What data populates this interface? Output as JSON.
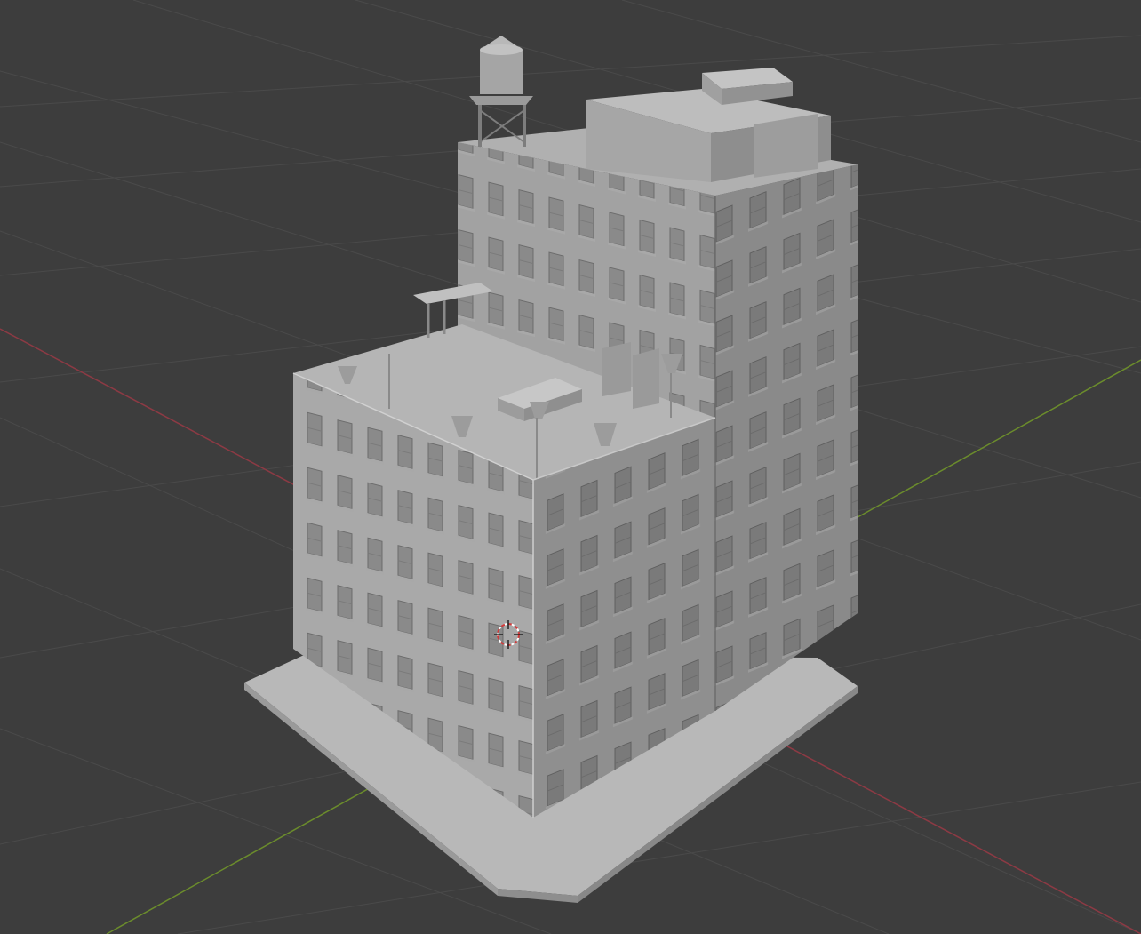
{
  "app": {
    "name": "3D viewport"
  },
  "scene": {
    "background": "#3d3d3d",
    "grid_color": "#4a4a4a",
    "x_axis_color": "#8c3a44",
    "y_axis_color": "#6b8c2c",
    "model_light": "#b3b3b3",
    "model_mid": "#9a9a9a",
    "model_dark": "#858585",
    "cursor_color": "#d23a3a",
    "cursor_accent": "#ffffff",
    "objects": [
      "building",
      "base-plate",
      "water-tower",
      "rooftop-units",
      "3d-cursor"
    ]
  }
}
